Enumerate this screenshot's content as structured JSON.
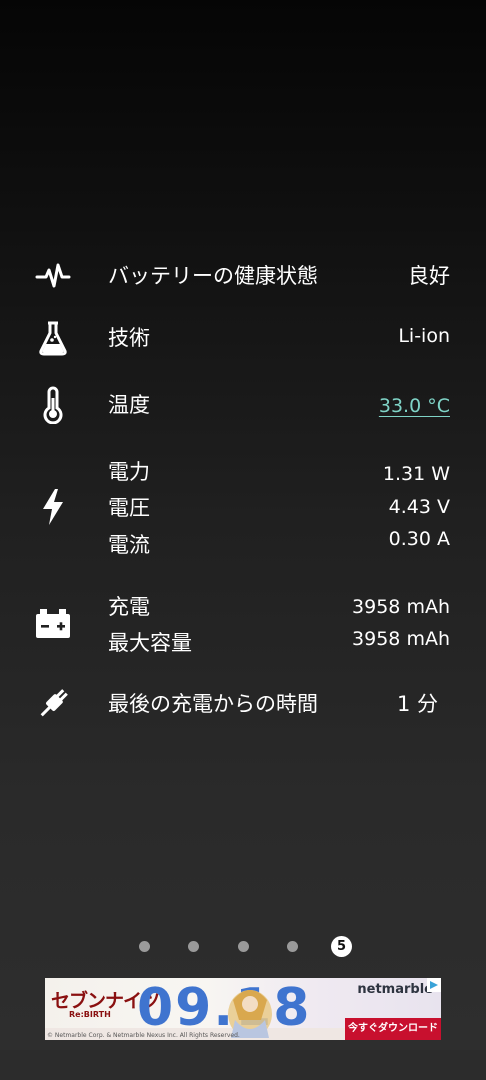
{
  "rows": {
    "health": {
      "icon": "heartbeat-icon",
      "label": "バッテリーの健康状態",
      "value": "良好"
    },
    "technology": {
      "icon": "flask-icon",
      "label": "技術",
      "value": "Li-ion"
    },
    "temperature": {
      "icon": "thermometer-icon",
      "label": "温度",
      "value": "33.0 °C"
    },
    "electrical": {
      "icon": "lightning-bolt-icon",
      "power_label": "電力",
      "power_value": "1.31 W",
      "voltage_label": "電圧",
      "voltage_value": "4.43 V",
      "current_label": "電流",
      "current_value": "0.30 A"
    },
    "capacity": {
      "icon": "car-battery-icon",
      "charge_label": "充電",
      "charge_value": "3958 mAh",
      "max_label": "最大容量",
      "max_value": "3958 mAh"
    },
    "since_charge": {
      "icon": "power-plug-icon",
      "label": "最後の充電からの時間",
      "value": "1 分"
    }
  },
  "pager": {
    "count": 5,
    "active_index": 5,
    "active_label": "5"
  },
  "ad": {
    "game_title": "セブンナイツ",
    "game_subtitle": "Re:BIRTH",
    "date_text": "09.18",
    "brand": "netmarble",
    "cta": "今すぐダウンロード",
    "copyright": "© Netmarble Corp. & Netmarble Nexus Inc. All Rights Reserved."
  },
  "colors": {
    "accent_link": "#7fd3c6",
    "ad_blue": "#3f74cf",
    "ad_red": "#c8102e"
  }
}
